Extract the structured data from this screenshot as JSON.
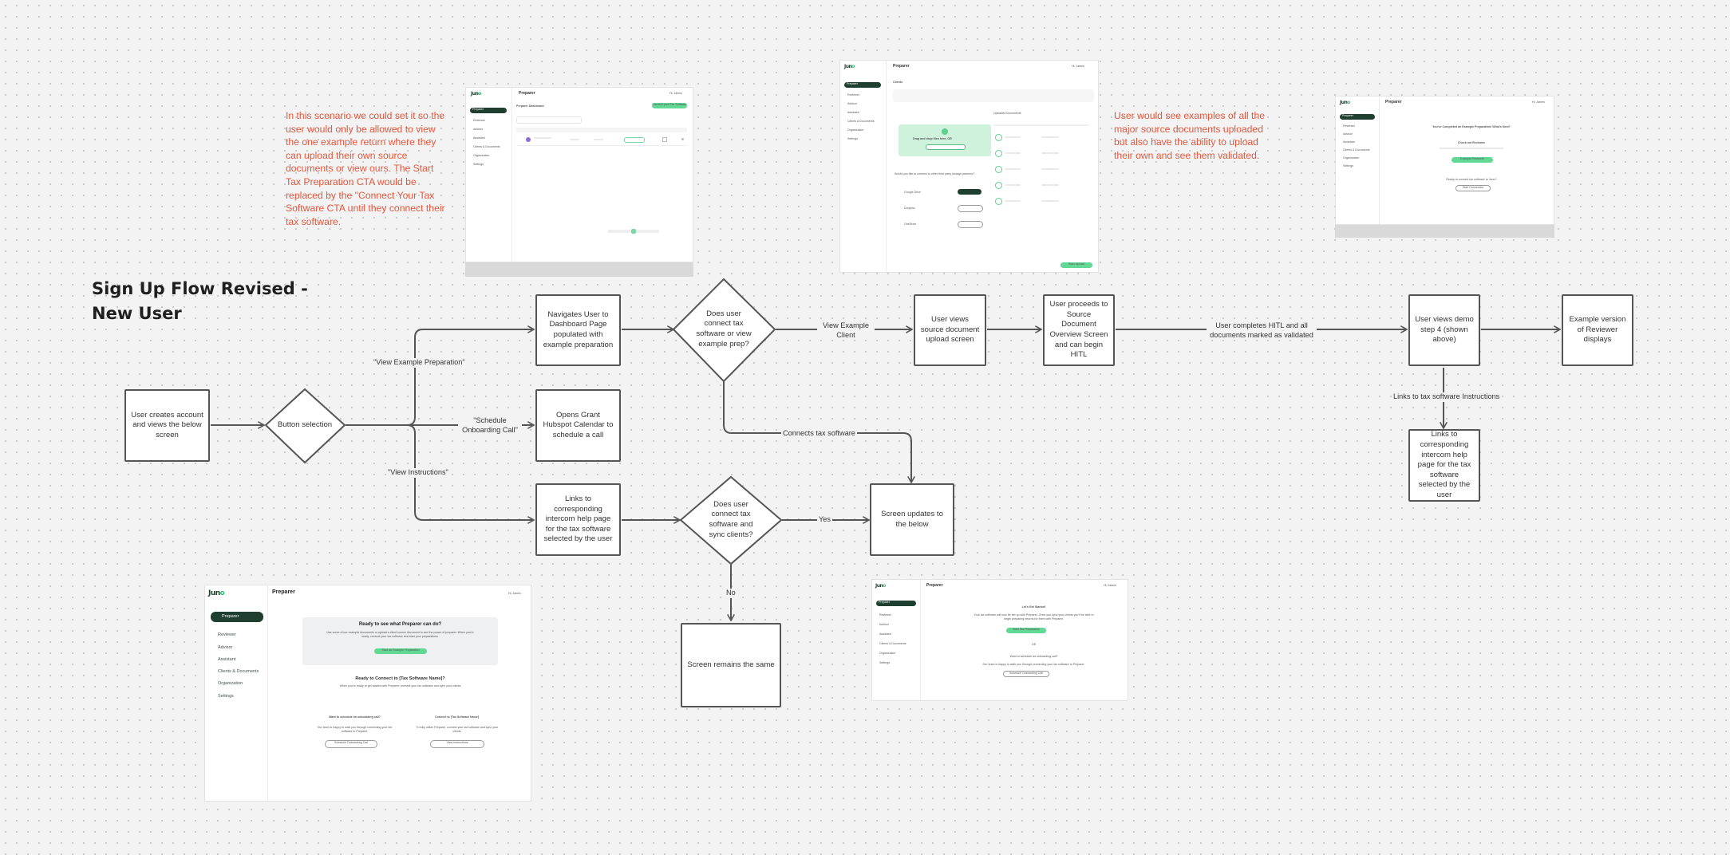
{
  "title": {
    "line1": "Sign Up Flow Revised -",
    "line2": "New User"
  },
  "notes": {
    "left": "In this scenario we could set it so the user would only be allowed to view the one example return where they can upload their own source documents or view ours. The Start Tax Preparation CTA would be replaced by the \"Connect Your Tax Software CTA until they connect their tax software.",
    "right": "User would see examples of all the major source documents uploaded but also have the ability to upload their own and see them validated."
  },
  "colors": {
    "arrow": "#555555",
    "note": "#e2583e",
    "accent": "#2fbf71",
    "nav_dark": "#1f4030"
  },
  "flow": {
    "start": "User creates account and views the below screen",
    "button_selection": "Button selection",
    "dashboard": "Navigates User to Dashboard Page populated with example preparation",
    "hubspot": "Opens Grant Hubspot Calendar to schedule a call",
    "intercom_left": "Links to corresponding intercom help page for the tax software selected by the user",
    "connect_decision": "Does user connect tax software or view example prep?",
    "sync_decision": "Does user connect tax software and sync clients?",
    "source_upload": "User views source document upload screen",
    "proceeds": "User proceeds to Source Document Overview Screen and can begin HITL",
    "demo_step": "User views demo step 4 (shown above)",
    "example_reviewer": "Example version of Reviewer displays",
    "intercom_right": "Links to corresponding intercom help page for the tax software selected by the user",
    "screen_updates": "Screen updates to the below",
    "screen_same": "Screen remains the same"
  },
  "edge_labels": {
    "view_example_prep": "\"View Example Preparation\"",
    "schedule_call": "\"Schedule Onboarding Call\"",
    "view_instructions": "\"View Instructions\"",
    "view_example_client": "View Example Client",
    "connects_tax_software": "Connects tax software",
    "hitl_complete": "User completes HITL and all documents marked as validated",
    "links_instructions": "Links to tax software Instructions",
    "yes": "Yes",
    "no": "No"
  },
  "mockups": {
    "logo_a": "Jun",
    "logo_b": "o",
    "app": "Preparer",
    "user": "Hi, James",
    "nav": [
      "Preparer",
      "Reviewer",
      "Advisor",
      "Assistant",
      "Clients & Documents",
      "Organization",
      "Settings"
    ],
    "dashboard": {
      "heading": "Preparer Dashboard",
      "cta": "Connect your Tax Software"
    },
    "clients": {
      "heading": "Clients",
      "upload_title": "Drag and drop files here, OR",
      "uploaded_heading": "Uploaded Documents",
      "start_label": "Start Upload",
      "connect_label": "Would you like to connect to other third party storage partners?",
      "partners": [
        "Google Drive",
        "Dropbox",
        "OneDrive"
      ]
    },
    "complete": {
      "heading": "You've Completed an Example Preparation! What's Next?",
      "sub": "Check out Reviewer",
      "cta": "Example Reviewer",
      "q": "Ready to connect tax software to Juno?",
      "btn": "Start Connection"
    },
    "bottom_left": {
      "hero_title": "Ready to see what Preparer can do?",
      "hero_text": "Use some of our example documents or upload a client source document to see the power of preparer. When you're ready, connect your tax software and start your preparations.",
      "hero_cta": "Start an Example Preparation",
      "connect_title": "Ready to Connect to [Tax Software Name]?",
      "connect_text": "When you're ready to get started with Preparer, connect your tax software and sync your clients.",
      "left_title": "Want to schedule an onboarding call?",
      "left_text": "Our team is happy to walk you through connecting your tax software to Preparer.",
      "left_btn": "Schedule Onboarding Call",
      "right_title": "Connect to [Tax Software Name]",
      "right_text": "To fully utilize Preparer, connect your tax software and sync your clients.",
      "right_btn": "View Instructions"
    },
    "bottom_right": {
      "title": "Let's Get Started!",
      "text": "Your tax software will now be set up with Preparer. Once you sync your clients you'll be able to begin preparing returns for them with Preparer.",
      "cta": "Start Tax Preparation",
      "or": "OR",
      "q": "Want to schedule an onboarding call?",
      "qtext": "Our team is happy to walk you through connecting your tax software to Preparer.",
      "btn": "Schedule Onboarding Call"
    }
  }
}
